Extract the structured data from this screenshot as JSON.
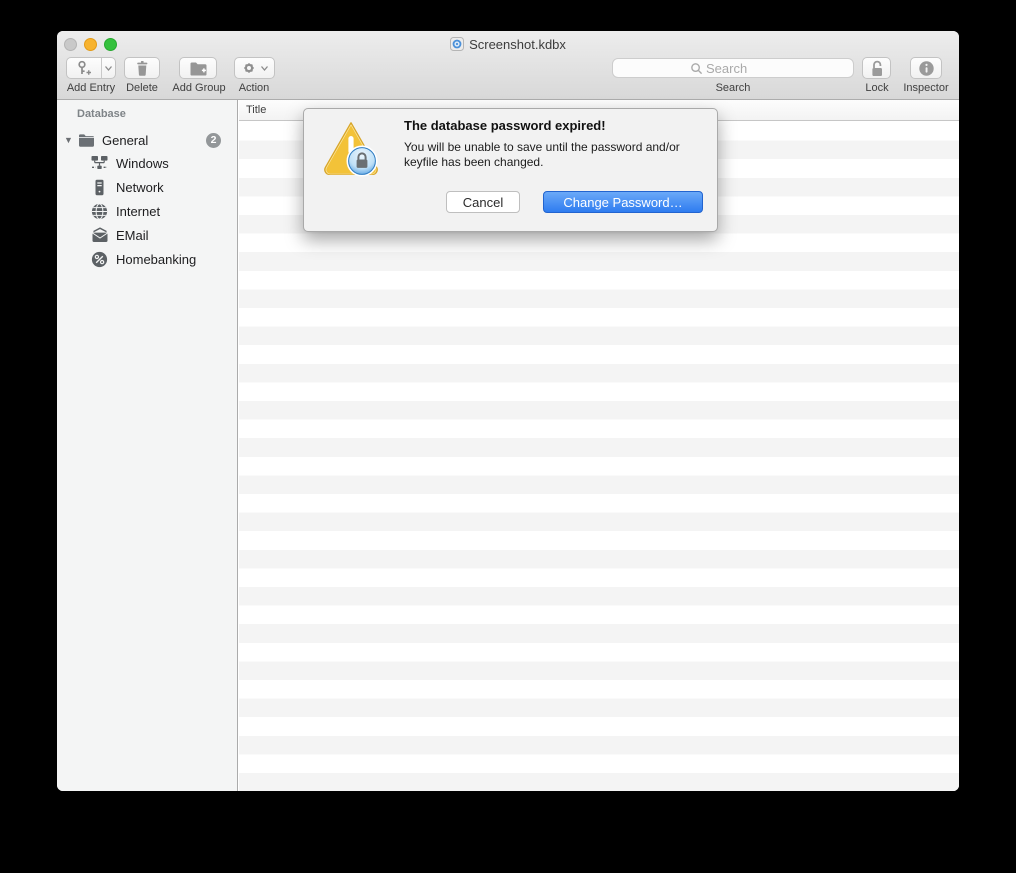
{
  "window": {
    "title": "Screenshot.kdbx"
  },
  "traffic_lights": [
    {
      "name": "close",
      "color": "#c9c9c9"
    },
    {
      "name": "minimize",
      "color": "#f7b32f"
    },
    {
      "name": "zoom",
      "color": "#35c13e"
    }
  ],
  "toolbar": {
    "add_entry_label": "Add Entry",
    "delete_label": "Delete",
    "add_group_label": "Add Group",
    "action_label": "Action",
    "search_placeholder": "Search",
    "search_label": "Search",
    "lock_label": "Lock",
    "inspector_label": "Inspector"
  },
  "sidebar": {
    "header": "Database",
    "group": {
      "label": "General",
      "badge": "2"
    },
    "items": [
      {
        "label": "Windows",
        "icon": "windows-network-icon"
      },
      {
        "label": "Network",
        "icon": "server-icon"
      },
      {
        "label": "Internet",
        "icon": "globe-icon"
      },
      {
        "label": "EMail",
        "icon": "envelope-icon"
      },
      {
        "label": "Homebanking",
        "icon": "percent-icon"
      }
    ]
  },
  "main": {
    "column_title": "Title"
  },
  "dialog": {
    "title": "The database password expired!",
    "body_line1": "You will be unable to save until the password and/or",
    "body_line2": "keyfile has been changed.",
    "cancel_label": "Cancel",
    "confirm_label": "Change Password…"
  },
  "colors": {
    "accent_blue": "#2e7cf0",
    "warning_yellow": "#f3c238",
    "chrome_gray": "#e0e0e0",
    "sidebar_bg": "#f4f5f5",
    "row_stripe": "#f4f4f4"
  }
}
